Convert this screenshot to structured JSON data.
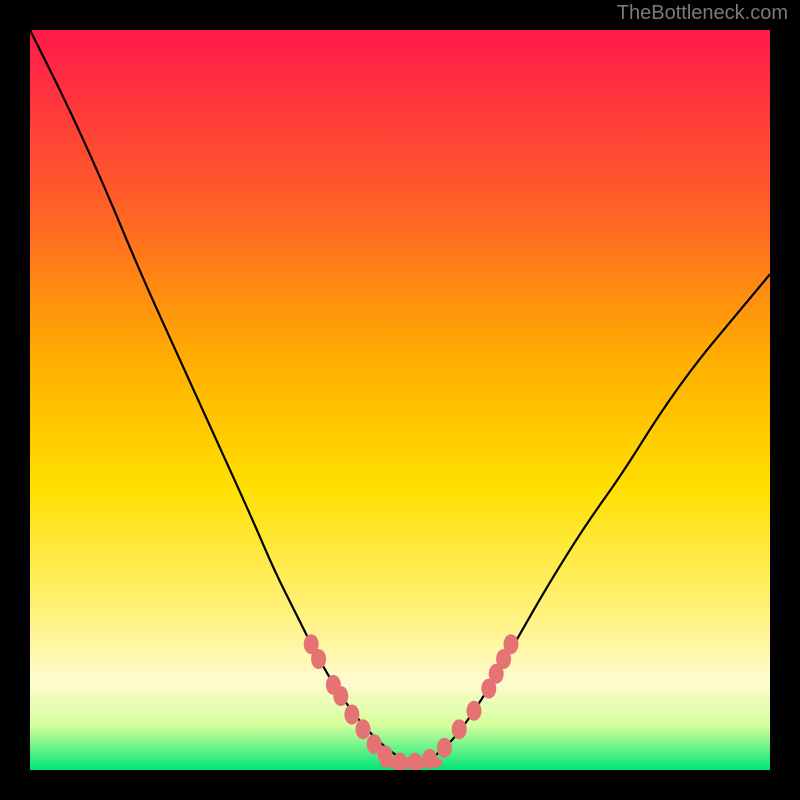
{
  "attribution": "TheBottleneck.com",
  "colors": {
    "gradient_top": "#ff1a4b",
    "gradient_mid1": "#ff7a1f",
    "gradient_mid2": "#ffd400",
    "gradient_mid3": "#fff176",
    "gradient_mid4": "#fff8b0",
    "gradient_bottom": "#00e676",
    "curve": "#000000",
    "marker": "#e57373",
    "frame": "#000000"
  },
  "chart_data": {
    "type": "line",
    "title": "",
    "xlabel": "",
    "ylabel": "",
    "xlim": [
      0,
      100
    ],
    "ylim": [
      0,
      100
    ],
    "grid": false,
    "series": [
      {
        "name": "bottleneck-v-curve",
        "x": [
          0,
          5,
          10,
          15,
          20,
          25,
          30,
          33,
          36,
          39,
          42,
          45,
          48,
          51,
          53,
          55,
          58,
          62,
          66,
          70,
          75,
          80,
          85,
          90,
          95,
          100
        ],
        "y": [
          100,
          90,
          79,
          67,
          56,
          45,
          34,
          27,
          21,
          15,
          10,
          6,
          3,
          1,
          1,
          2,
          5,
          11,
          18,
          25,
          33,
          40,
          48,
          55,
          61,
          67
        ]
      }
    ],
    "markers": [
      {
        "x": 38,
        "y": 17
      },
      {
        "x": 39,
        "y": 15
      },
      {
        "x": 41,
        "y": 11.5
      },
      {
        "x": 42,
        "y": 10
      },
      {
        "x": 43.5,
        "y": 7.5
      },
      {
        "x": 45,
        "y": 5.5
      },
      {
        "x": 46.5,
        "y": 3.5
      },
      {
        "x": 48,
        "y": 2
      },
      {
        "x": 50,
        "y": 1
      },
      {
        "x": 52,
        "y": 1
      },
      {
        "x": 54,
        "y": 1.5
      },
      {
        "x": 56,
        "y": 3
      },
      {
        "x": 58,
        "y": 5.5
      },
      {
        "x": 60,
        "y": 8
      },
      {
        "x": 62,
        "y": 11
      },
      {
        "x": 63,
        "y": 13
      },
      {
        "x": 64,
        "y": 15
      },
      {
        "x": 65,
        "y": 17
      }
    ],
    "plateau_line": {
      "x1": 48,
      "x2": 55,
      "y": 1
    }
  }
}
